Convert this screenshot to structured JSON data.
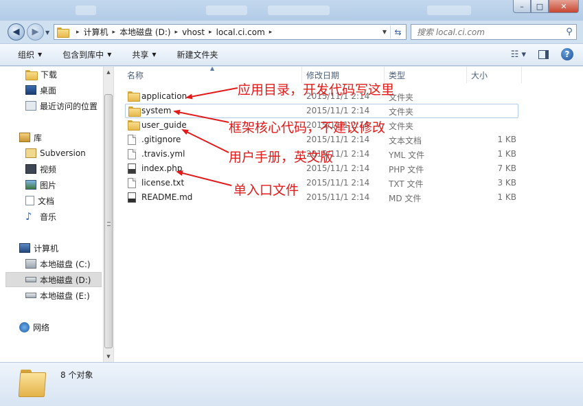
{
  "window": {
    "controls": {
      "minimize": "–",
      "maximize": "□",
      "close": "✕"
    }
  },
  "navbar": {
    "breadcrumb": [
      "计算机",
      "本地磁盘 (D:)",
      "vhost",
      "local.ci.com"
    ],
    "search_placeholder": "搜索 local.ci.com"
  },
  "toolbar": {
    "organize": "组织",
    "include_in_library": "包含到库中",
    "share": "共享",
    "new_folder": "新建文件夹"
  },
  "sidebar": {
    "items": [
      {
        "label": "下载",
        "icon": "folder-icon"
      },
      {
        "label": "桌面",
        "icon": "desktop-icon"
      },
      {
        "label": "最近访问的位置",
        "icon": "recent-places-icon"
      },
      {
        "label": "库",
        "icon": "library-icon"
      },
      {
        "label": "Subversion",
        "icon": "folder-icon"
      },
      {
        "label": "视频",
        "icon": "video-icon"
      },
      {
        "label": "图片",
        "icon": "picture-icon"
      },
      {
        "label": "文档",
        "icon": "document-icon"
      },
      {
        "label": "音乐",
        "icon": "music-icon"
      },
      {
        "label": "计算机",
        "icon": "computer-icon"
      },
      {
        "label": "本地磁盘 (C:)",
        "icon": "system-drive-icon"
      },
      {
        "label": "本地磁盘 (D:)",
        "icon": "drive-icon"
      },
      {
        "label": "本地磁盘 (E:)",
        "icon": "drive-icon"
      },
      {
        "label": "网络",
        "icon": "network-icon"
      }
    ]
  },
  "columns": {
    "name": "名称",
    "modified": "修改日期",
    "type": "类型",
    "size": "大小"
  },
  "files": [
    {
      "name": "application",
      "modified": "2015/11/1 2:14",
      "type": "文件夹",
      "size": "",
      "icon": "folder-icon"
    },
    {
      "name": "system",
      "modified": "2015/11/1 2:14",
      "type": "文件夹",
      "size": "",
      "icon": "folder-icon"
    },
    {
      "name": "user_guide",
      "modified": "2015/11/1 2:14",
      "type": "文件夹",
      "size": "",
      "icon": "folder-icon"
    },
    {
      "name": ".gitignore",
      "modified": "2015/11/1 2:14",
      "type": "文本文档",
      "size": "1 KB",
      "icon": "text-file-icon"
    },
    {
      "name": ".travis.yml",
      "modified": "2015/11/1 2:14",
      "type": "YML 文件",
      "size": "1 KB",
      "icon": "file-icon"
    },
    {
      "name": "index.php",
      "modified": "2015/11/1 2:14",
      "type": "PHP 文件",
      "size": "7 KB",
      "icon": "php-file-icon"
    },
    {
      "name": "license.txt",
      "modified": "2015/11/1 2:14",
      "type": "TXT 文件",
      "size": "3 KB",
      "icon": "text-file-icon"
    },
    {
      "name": "README.md",
      "modified": "2015/11/1 2:14",
      "type": "MD 文件",
      "size": "1 KB",
      "icon": "md-file-icon"
    }
  ],
  "annotations": [
    "应用目录，开发代码写这里",
    "框架核心代码，不建议修改",
    "用户手册，英文版",
    "单入口文件"
  ],
  "annotation_color": "#e21a1a",
  "status": {
    "item_count": "8 个对象"
  }
}
